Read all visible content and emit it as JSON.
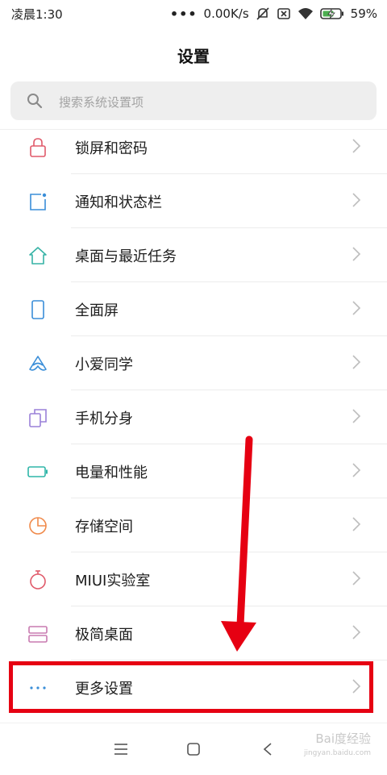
{
  "status_bar": {
    "time": "凌晨1:30",
    "dots": "•••",
    "network_speed": "0.00K/s",
    "battery": "59%"
  },
  "header": {
    "title": "设置"
  },
  "search": {
    "placeholder": "搜索系统设置项"
  },
  "settings": [
    {
      "label": "锁屏和密码",
      "icon": "lock-icon",
      "color": "#e05a6a"
    },
    {
      "label": "通知和状态栏",
      "icon": "notification-icon",
      "color": "#3a8ed8"
    },
    {
      "label": "桌面与最近任务",
      "icon": "home-icon",
      "color": "#37b3a6"
    },
    {
      "label": "全面屏",
      "icon": "phone-icon",
      "color": "#3a8ed8"
    },
    {
      "label": "小爱同学",
      "icon": "xiaoai-icon",
      "color": "#3a8ed8"
    },
    {
      "label": "手机分身",
      "icon": "clone-icon",
      "color": "#9a80d8"
    },
    {
      "label": "电量和性能",
      "icon": "battery-icon",
      "color": "#2fb5a8"
    },
    {
      "label": "存储空间",
      "icon": "storage-icon",
      "color": "#f08a4b"
    },
    {
      "label": "MIUI实验室",
      "icon": "lab-flask-icon",
      "color": "#e05a6a"
    },
    {
      "label": "极简桌面",
      "icon": "simple-desktop-icon",
      "color": "#c87ab0"
    },
    {
      "label": "更多设置",
      "icon": "more-icon",
      "color": "#3a8ed8"
    }
  ],
  "colors": {
    "highlight": "#e60012",
    "chevron": "#bdbdbd"
  },
  "nav": {
    "menu_icon": "menu-icon",
    "home_icon": "home-square-icon",
    "back_icon": "back-icon"
  },
  "watermark": {
    "text": "Bai度经验",
    "url": "jingyan.baidu.com"
  }
}
